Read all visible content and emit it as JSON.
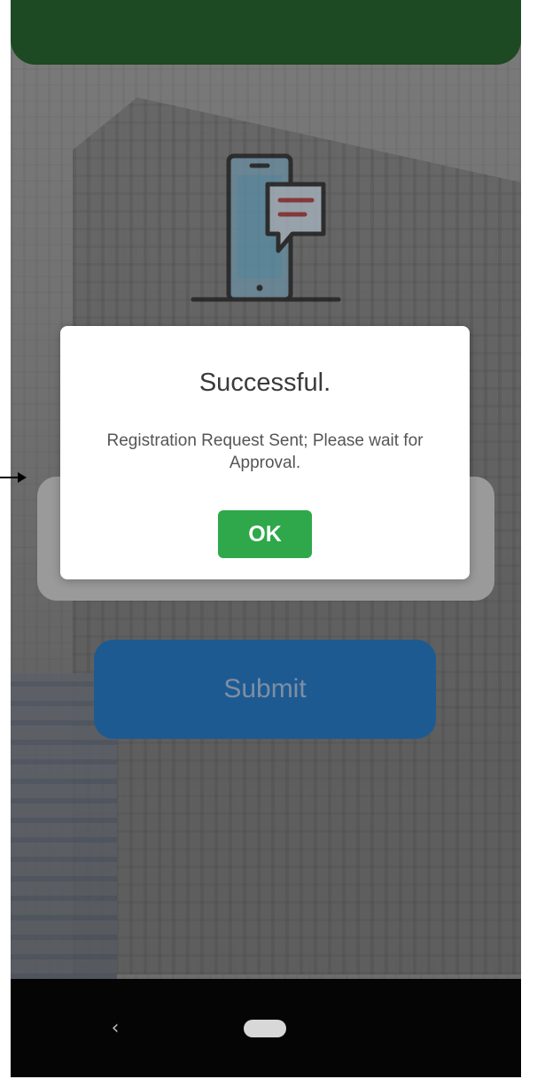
{
  "dialog": {
    "title": "Successful.",
    "message": "Registration Request Sent; Please wait for Approval.",
    "ok_label": "OK"
  },
  "form": {
    "submit_label": "Submit"
  },
  "navigation": {
    "back_glyph": "‹"
  },
  "colors": {
    "header_green": "#1d4a22",
    "submit_blue": "#1e5a92",
    "ok_green": "#2ea84a"
  },
  "icons": [
    "phone-message-icon",
    "back-icon",
    "home-icon",
    "pointer-arrow-icon"
  ]
}
